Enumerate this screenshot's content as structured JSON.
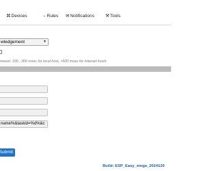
{
  "tabs": [
    {
      "icon": "devices-icon",
      "glyph": "⌘",
      "label": "Devices"
    },
    {
      "icon": "rules-icon",
      "glyph": "→",
      "label": "Rules"
    },
    {
      "icon": "notifications-icon",
      "glyph": "✉",
      "label": "Notifications"
    },
    {
      "icon": "tools-icon",
      "glyph": "⚒",
      "label": "Tools"
    }
  ],
  "form": {
    "select_value": "wledgement",
    "hint": "meout: 100...300 msec for local host, >500 msec for internet hosts",
    "inputs": [
      "",
      "",
      "",
      "name%&taskid=%d%&c"
    ],
    "submit_label": "Submit"
  },
  "footer": {
    "build": "Build: ESP_Easy_mega_2024120"
  }
}
